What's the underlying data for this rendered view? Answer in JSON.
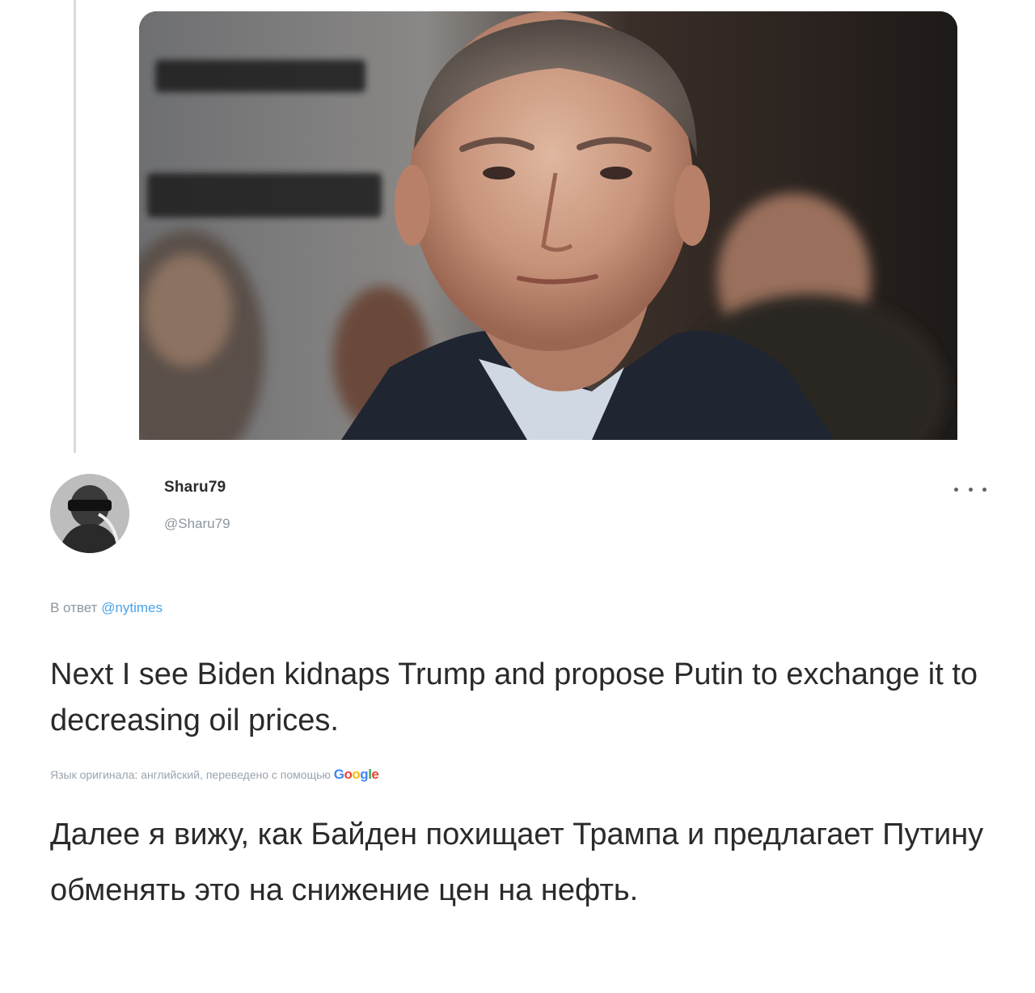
{
  "thread": {
    "photo_icon": "photo-media"
  },
  "tweet": {
    "author": {
      "display_name": "Sharu79",
      "handle": "@Sharu79",
      "avatar_icon": "user-avatar"
    },
    "more_icon": "more-horizontal-icon",
    "reply_to": {
      "prefix": "В ответ",
      "mention": "@nytimes"
    },
    "text": "Next I see Biden kidnaps Trump and propose Putin to exchange it to decreasing oil prices.",
    "translation_note": "Язык оригинала: английский, переведено с помощью",
    "translation_provider": "Google",
    "translated_text": "Далее я вижу, как Байден похищает Трампа и предлагает Путину обменять это на снижение цен на нефть."
  },
  "colors": {
    "text": "#2a2a2a",
    "muted": "#8c969f",
    "link": "#4aa3e8"
  }
}
